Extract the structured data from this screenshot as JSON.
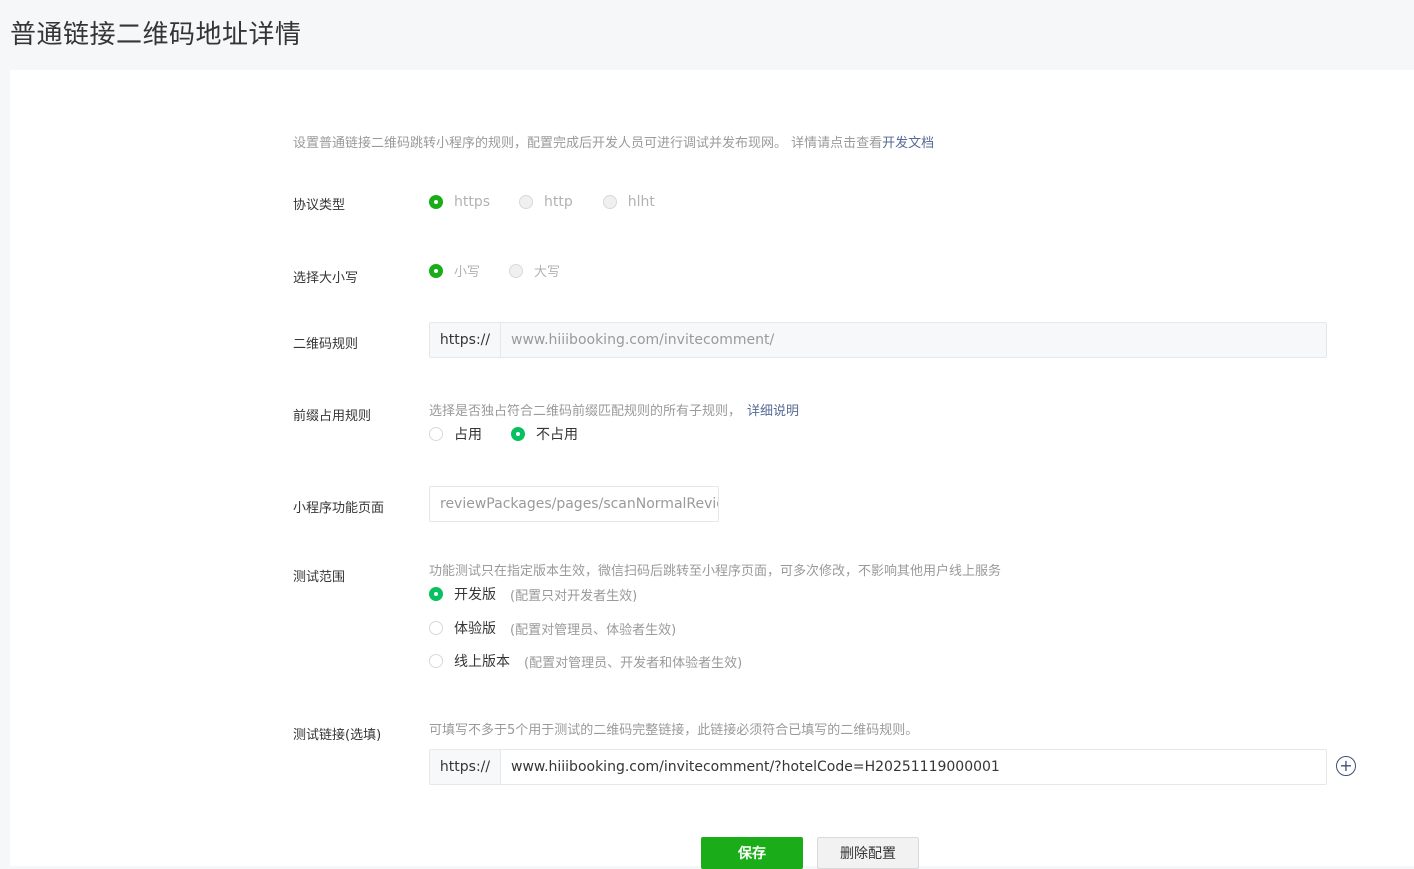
{
  "header": {
    "title": "普通链接二维码地址详情"
  },
  "intro": {
    "text": "设置普通链接二维码跳转小程序的规则，配置完成后开发人员可进行调试并发布现网。 详情请点击查看",
    "link": "开发文档"
  },
  "protocol": {
    "label": "协议类型",
    "options": [
      {
        "label": "https",
        "selected": true
      },
      {
        "label": "http",
        "selected": false
      },
      {
        "label": "hlht",
        "selected": false
      }
    ]
  },
  "case": {
    "label": "选择大小写",
    "options": [
      {
        "label": "小写",
        "selected": true
      },
      {
        "label": "大写",
        "selected": false
      }
    ]
  },
  "qr_rule": {
    "label": "二维码规则",
    "prefix": "https://",
    "value": "www.hiiibooking.com/invitecomment/"
  },
  "prefix_rule": {
    "label": "前缀占用规则",
    "desc": "选择是否独占符合二维码前缀匹配规则的所有子规则，",
    "link": "详细说明",
    "options": [
      {
        "label": "占用",
        "selected": false
      },
      {
        "label": "不占用",
        "selected": true
      }
    ]
  },
  "page_path": {
    "label": "小程序功能页面",
    "value": "reviewPackages/pages/scanNormalReview"
  },
  "test_scope": {
    "label": "测试范围",
    "desc": "功能测试只在指定版本生效，微信扫码后跳转至小程序页面，可多次修改，不影响其他用户线上服务",
    "options": [
      {
        "label": "开发版",
        "note": "(配置只对开发者生效)",
        "selected": true
      },
      {
        "label": "体验版",
        "note": "(配置对管理员、体验者生效)",
        "selected": false
      },
      {
        "label": "线上版本",
        "note": "(配置对管理员、开发者和体验者生效)",
        "selected": false
      }
    ]
  },
  "test_link": {
    "label": "测试链接(选填)",
    "desc": "可填写不多于5个用于测试的二维码完整链接，此链接必须符合已填写的二维码规则。",
    "prefix": "https://",
    "value": "www.hiiibooking.com/invitecomment/?hotelCode=H20251119000001",
    "add_icon": "plus-circle-icon"
  },
  "actions": {
    "save": "保存",
    "delete": "删除配置"
  },
  "colors": {
    "primary": "#1aad19",
    "radio_on": "#07c160",
    "link": "#576b95",
    "muted": "#9a9a9a"
  }
}
